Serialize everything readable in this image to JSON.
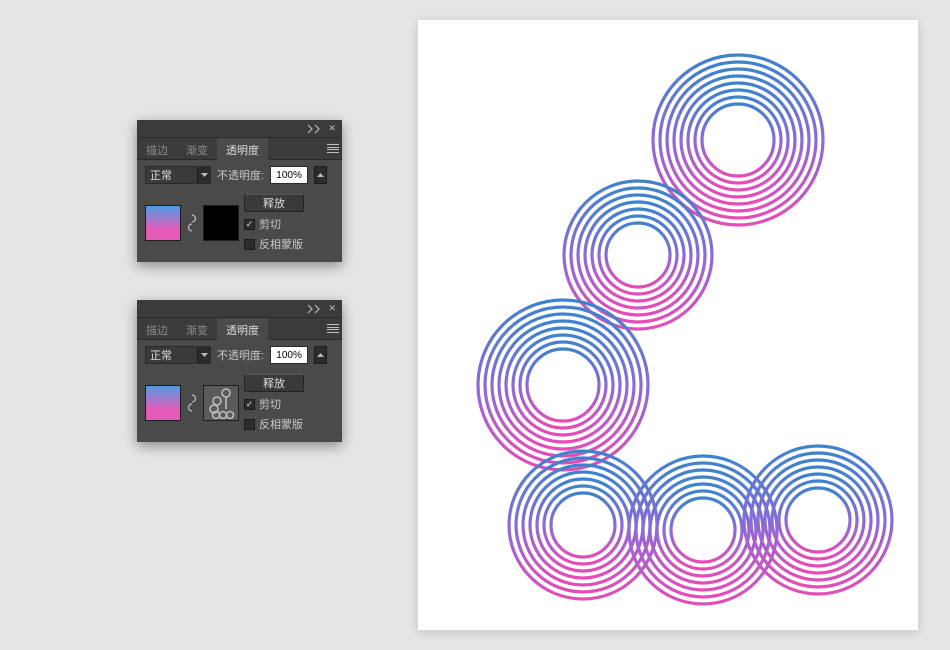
{
  "panels": [
    {
      "tabs": {
        "stroke": "描边",
        "gradient": "渐变",
        "transparency": "透明度"
      },
      "mode": "正常",
      "opacityLabel": "不透明度:",
      "opacityValue": "100%",
      "releaseBtn": "释放",
      "clipLabel": "剪切",
      "clipChecked": true,
      "invertMaskLabel": "反相蒙版",
      "invertMaskChecked": false,
      "maskThumb": "black"
    },
    {
      "tabs": {
        "stroke": "描边",
        "gradient": "渐变",
        "transparency": "透明度"
      },
      "mode": "正常",
      "opacityLabel": "不透明度:",
      "opacityValue": "100%",
      "releaseBtn": "释放",
      "clipLabel": "剪切",
      "clipChecked": true,
      "invertMaskLabel": "反相蒙版",
      "invertMaskChecked": false,
      "maskThumb": "artwork"
    }
  ],
  "artwork": {
    "colorTop": "#3f82cc",
    "colorBottom": "#e44db6"
  }
}
